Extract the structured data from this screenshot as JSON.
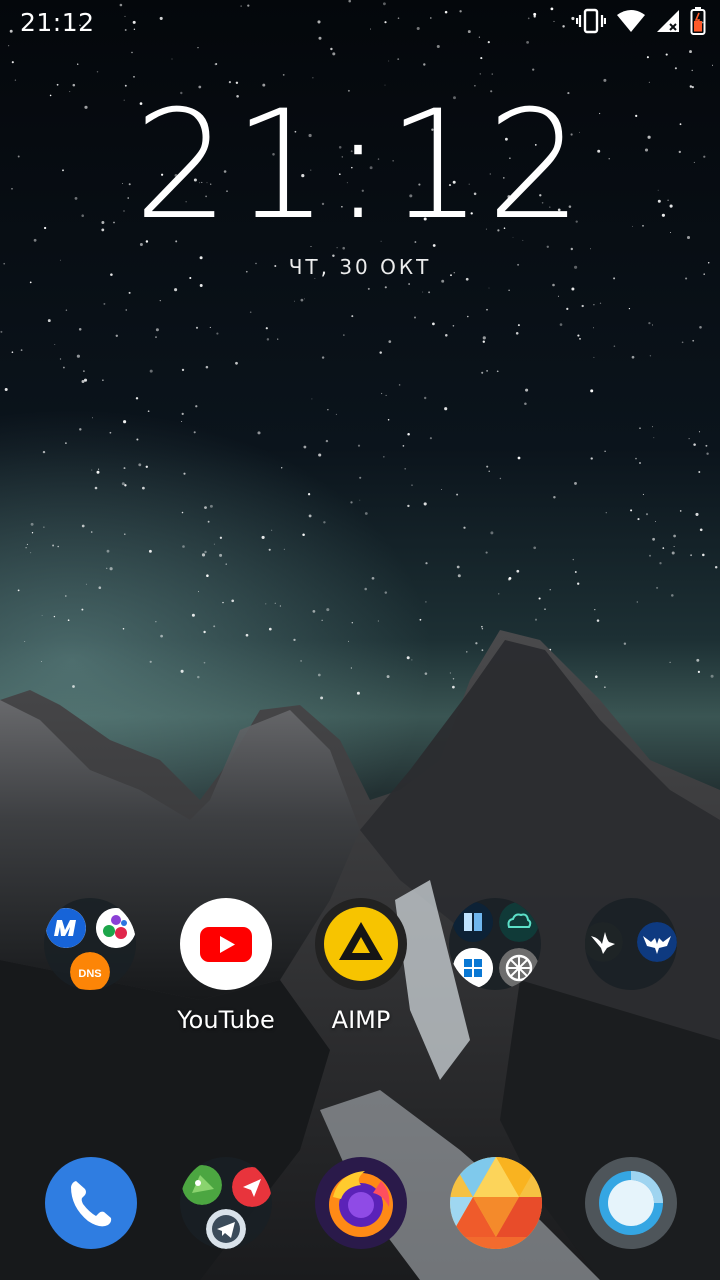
{
  "status_bar": {
    "time": "21:12",
    "icons": [
      "vibrate-icon",
      "wifi-icon",
      "cellular-no-data-icon",
      "battery-low-icon"
    ]
  },
  "clock": {
    "time": "21:12",
    "date": "ЧТ, 30 ОКТ"
  },
  "home_row": [
    {
      "type": "folder",
      "apps": [
        "mosenergo-icon",
        "colorful-dots-icon",
        "dns-icon"
      ],
      "label": ""
    },
    {
      "type": "app",
      "label": "YouTube",
      "icon": "youtube-icon"
    },
    {
      "type": "app",
      "label": "AIMP",
      "icon": "aimp-icon"
    },
    {
      "type": "folder",
      "apps": [
        "book-reader-icon",
        "cloud-face-icon",
        "windows-icon",
        "wheel-icon"
      ],
      "label": ""
    },
    {
      "type": "folder",
      "apps": [
        "white-bird-icon",
        "eagle-emblem-icon"
      ],
      "label": ""
    }
  ],
  "dock": [
    {
      "type": "app",
      "icon": "phone-icon"
    },
    {
      "type": "folder",
      "apps": [
        "green-chat-icon",
        "red-arrow-icon",
        "telegram-icon"
      ]
    },
    {
      "type": "app",
      "icon": "firefox-icon"
    },
    {
      "type": "app",
      "icon": "polygon-gallery-icon"
    },
    {
      "type": "app",
      "icon": "ring-camera-icon"
    }
  ],
  "colors": {
    "youtube_red": "#ff0000",
    "aimp_yellow": "#f7c400",
    "phone_blue": "#2f7de1",
    "firefox_orange": "#ff8a16",
    "telegram_blue": "#2aa3e0"
  }
}
